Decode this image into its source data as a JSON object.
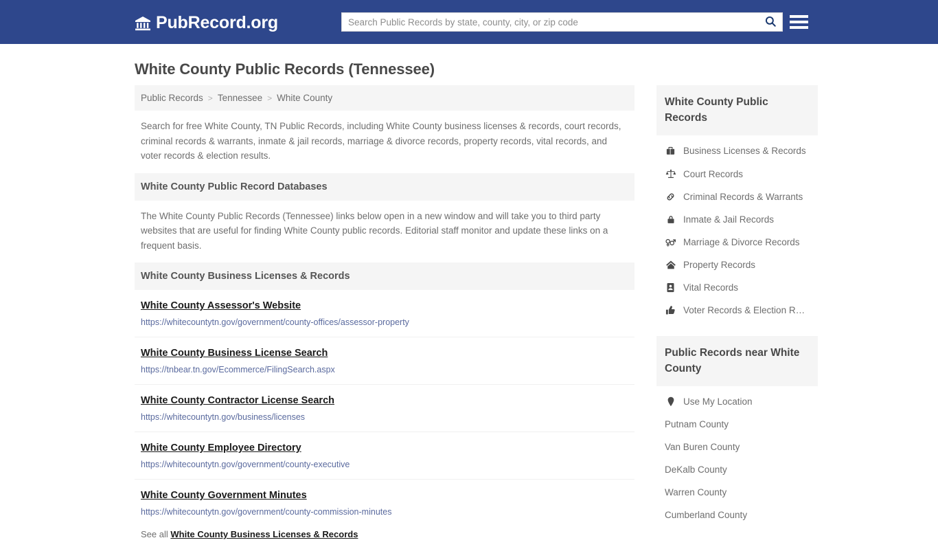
{
  "header": {
    "brand_name": "PubRecord.org",
    "brand_icon": "bank-icon",
    "search_placeholder": "Search Public Records by state, county, city, or zip code",
    "search_value": "",
    "search_icon": "search-icon",
    "menu_icon": "hamburger-menu-icon",
    "background_color": "#2e478c"
  },
  "page": {
    "title": "White County Public Records (Tennessee)",
    "breadcrumb": [
      {
        "label": "Public Records"
      },
      {
        "label": "Tennessee"
      },
      {
        "label": "White County"
      }
    ],
    "breadcrumb_separator": ">",
    "intro": "Search for free White County, TN Public Records, including White County business licenses & records, court records, criminal records & warrants, inmate & jail records, marriage & divorce records, property records, vital records, and voter records & election results.",
    "databases_heading": "White County Public Record Databases",
    "databases_text": "The White County Public Records (Tennessee) links below open in a new window and will take you to third party websites that are useful for finding White County public records. Editorial staff monitor and update these links on a frequent basis.",
    "business_heading": "White County Business Licenses & Records",
    "links": [
      {
        "title": "White County Assessor's Website",
        "url": "https://whitecountytn.gov/government/county-offices/assessor-property"
      },
      {
        "title": "White County Business License Search",
        "url": "https://tnbear.tn.gov/Ecommerce/FilingSearch.aspx"
      },
      {
        "title": "White County Contractor License Search",
        "url": "https://whitecountytn.gov/business/licenses"
      },
      {
        "title": "White County Employee Directory",
        "url": "https://whitecountytn.gov/government/county-executive"
      },
      {
        "title": "White County Government Minutes",
        "url": "https://whitecountytn.gov/government/county-commission-minutes"
      }
    ],
    "see_all_prefix": "See all ",
    "see_all_link": "White County Business Licenses & Records"
  },
  "sidebar": {
    "records_heading": "White County Public Records",
    "records_items": [
      {
        "label": "Business Licenses & Records",
        "icon": "briefcase-icon"
      },
      {
        "label": "Court Records",
        "icon": "balance-scale-icon"
      },
      {
        "label": "Criminal Records & Warrants",
        "icon": "chain-link-icon"
      },
      {
        "label": "Inmate & Jail Records",
        "icon": "lock-icon"
      },
      {
        "label": "Marriage & Divorce Records",
        "icon": "venus-mars-icon"
      },
      {
        "label": "Property Records",
        "icon": "home-icon"
      },
      {
        "label": "Vital Records",
        "icon": "id-badge-icon"
      },
      {
        "label": "Voter Records & Election R…",
        "icon": "thumbs-up-icon"
      }
    ],
    "near_heading": "Public Records near White County",
    "near_items": [
      {
        "label": "Use My Location",
        "icon": "map-pin-icon"
      },
      {
        "label": "Putnam County",
        "icon": ""
      },
      {
        "label": "Van Buren County",
        "icon": ""
      },
      {
        "label": "DeKalb County",
        "icon": ""
      },
      {
        "label": "Warren County",
        "icon": ""
      },
      {
        "label": "Cumberland County",
        "icon": ""
      }
    ]
  }
}
